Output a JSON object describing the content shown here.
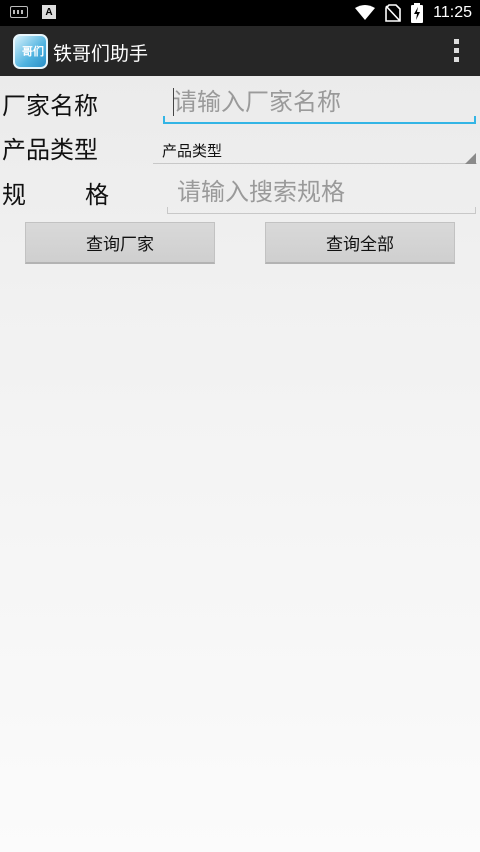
{
  "status_bar": {
    "time": "11:25",
    "notif_icon": "A"
  },
  "action_bar": {
    "title": "铁哥们助手",
    "icon_text": "哥们"
  },
  "form": {
    "manufacturer": {
      "label": "厂家名称",
      "placeholder": "请输入厂家名称",
      "value": ""
    },
    "product_type": {
      "label": "产品类型",
      "selected": "产品类型"
    },
    "spec": {
      "label_1": "规",
      "label_2": "格",
      "placeholder": "请输入搜索规格",
      "value": ""
    }
  },
  "buttons": {
    "query_manufacturer": "查询厂家",
    "query_all": "查询全部"
  },
  "colors": {
    "accent": "#33b5e5",
    "action_bar": "#262626",
    "status_bar": "#000000"
  }
}
